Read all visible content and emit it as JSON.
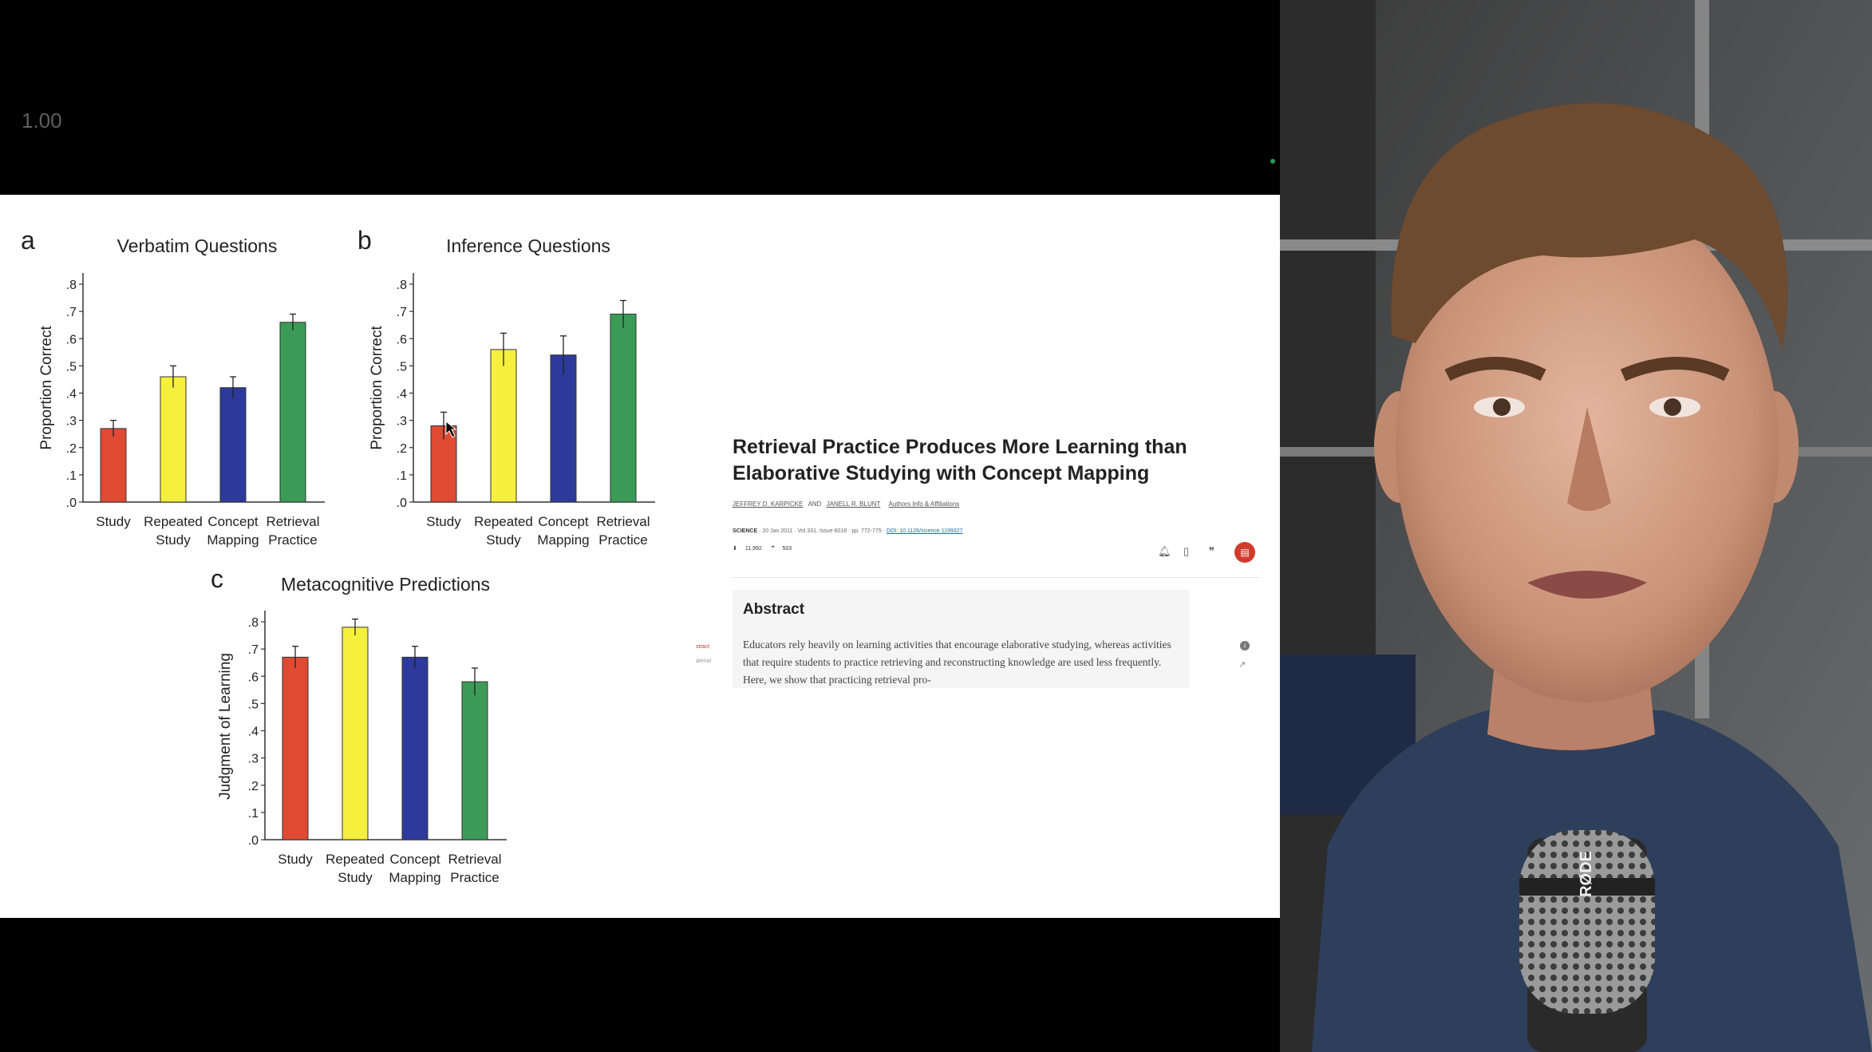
{
  "player": {
    "zoom": "1.00"
  },
  "colors": {
    "study": "#e04a33",
    "repeated_study": "#f5ef3d",
    "concept_mapping": "#2d3a9b",
    "retrieval_practice": "#3b9b57"
  },
  "chart_data": [
    {
      "panel": "a",
      "type": "bar",
      "title": "Verbatim Questions",
      "ylabel": "Proportion Correct",
      "categories": [
        [
          "Study"
        ],
        [
          "Repeated",
          "Study"
        ],
        [
          "Concept",
          "Mapping"
        ],
        [
          "Retrieval",
          "Practice"
        ]
      ],
      "values": [
        0.27,
        0.46,
        0.42,
        0.66
      ],
      "errors": [
        0.03,
        0.04,
        0.04,
        0.03
      ],
      "ylim": [
        0,
        0.8
      ],
      "yticks": [
        ".0",
        ".1",
        ".2",
        ".3",
        ".4",
        ".5",
        ".6",
        ".7",
        ".8"
      ],
      "yticks_values": [
        0,
        0.1,
        0.2,
        0.3,
        0.4,
        0.5,
        0.6,
        0.7,
        0.8
      ],
      "grid": false,
      "colors": [
        "#e04a33",
        "#f5ef3d",
        "#2d3a9b",
        "#3b9b57"
      ]
    },
    {
      "panel": "b",
      "type": "bar",
      "title": "Inference Questions",
      "ylabel": "Proportion Correct",
      "categories": [
        [
          "Study"
        ],
        [
          "Repeated",
          "Study"
        ],
        [
          "Concept",
          "Mapping"
        ],
        [
          "Retrieval",
          "Practice"
        ]
      ],
      "values": [
        0.28,
        0.56,
        0.54,
        0.69
      ],
      "errors": [
        0.05,
        0.06,
        0.07,
        0.05
      ],
      "ylim": [
        0,
        0.8
      ],
      "yticks": [
        ".0",
        ".1",
        ".2",
        ".3",
        ".4",
        ".5",
        ".6",
        ".7",
        ".8"
      ],
      "yticks_values": [
        0,
        0.1,
        0.2,
        0.3,
        0.4,
        0.5,
        0.6,
        0.7,
        0.8
      ],
      "grid": false,
      "colors": [
        "#e04a33",
        "#f5ef3d",
        "#2d3a9b",
        "#3b9b57"
      ]
    },
    {
      "panel": "c",
      "type": "bar",
      "title": "Metacognitive Predictions",
      "ylabel": "Judgment of Learning",
      "categories": [
        [
          "Study"
        ],
        [
          "Repeated",
          "Study"
        ],
        [
          "Concept",
          "Mapping"
        ],
        [
          "Retrieval",
          "Practice"
        ]
      ],
      "values": [
        0.67,
        0.78,
        0.67,
        0.58
      ],
      "errors": [
        0.04,
        0.03,
        0.04,
        0.05
      ],
      "ylim": [
        0,
        0.8
      ],
      "yticks": [
        ".0",
        ".1",
        ".2",
        ".3",
        ".4",
        ".5",
        ".6",
        ".7",
        ".8"
      ],
      "yticks_values": [
        0,
        0.1,
        0.2,
        0.3,
        0.4,
        0.5,
        0.6,
        0.7,
        0.8
      ],
      "grid": false,
      "colors": [
        "#e04a33",
        "#f5ef3d",
        "#2d3a9b",
        "#3b9b57"
      ]
    }
  ],
  "article": {
    "title": "Retrieval Practice Produces More Learning than Elaborative Studying with Concept Mapping",
    "author_1": "JEFFREY D. KARPICKE",
    "author_and": "AND",
    "author_2": "JANELL R. BLUNT",
    "authors_link": "Authors Info & Affiliations",
    "journal": "SCIENCE",
    "date": "20 Jan 2011",
    "volume": "Vol 331, Issue 6018",
    "pages": "pp. 772-775",
    "doi": "DOI: 10.1126/science.1199327",
    "downloads": "11,992",
    "citations": "503",
    "abstract_heading": "Abstract",
    "abstract_text": "Educators rely heavily on learning activities that encourage elaborative studying, whereas activities that require students to practice retrieving and reconstructing knowledge are used less frequently. Here, we show that practicing retrieval pro-",
    "side_link_1": "stract",
    "side_link_2": "aterial",
    "icons": [
      "download-icon",
      "quote-icon",
      "bell-icon",
      "bookmark-icon",
      "cite-icon",
      "pdf-icon",
      "info-icon",
      "trend-icon"
    ]
  }
}
